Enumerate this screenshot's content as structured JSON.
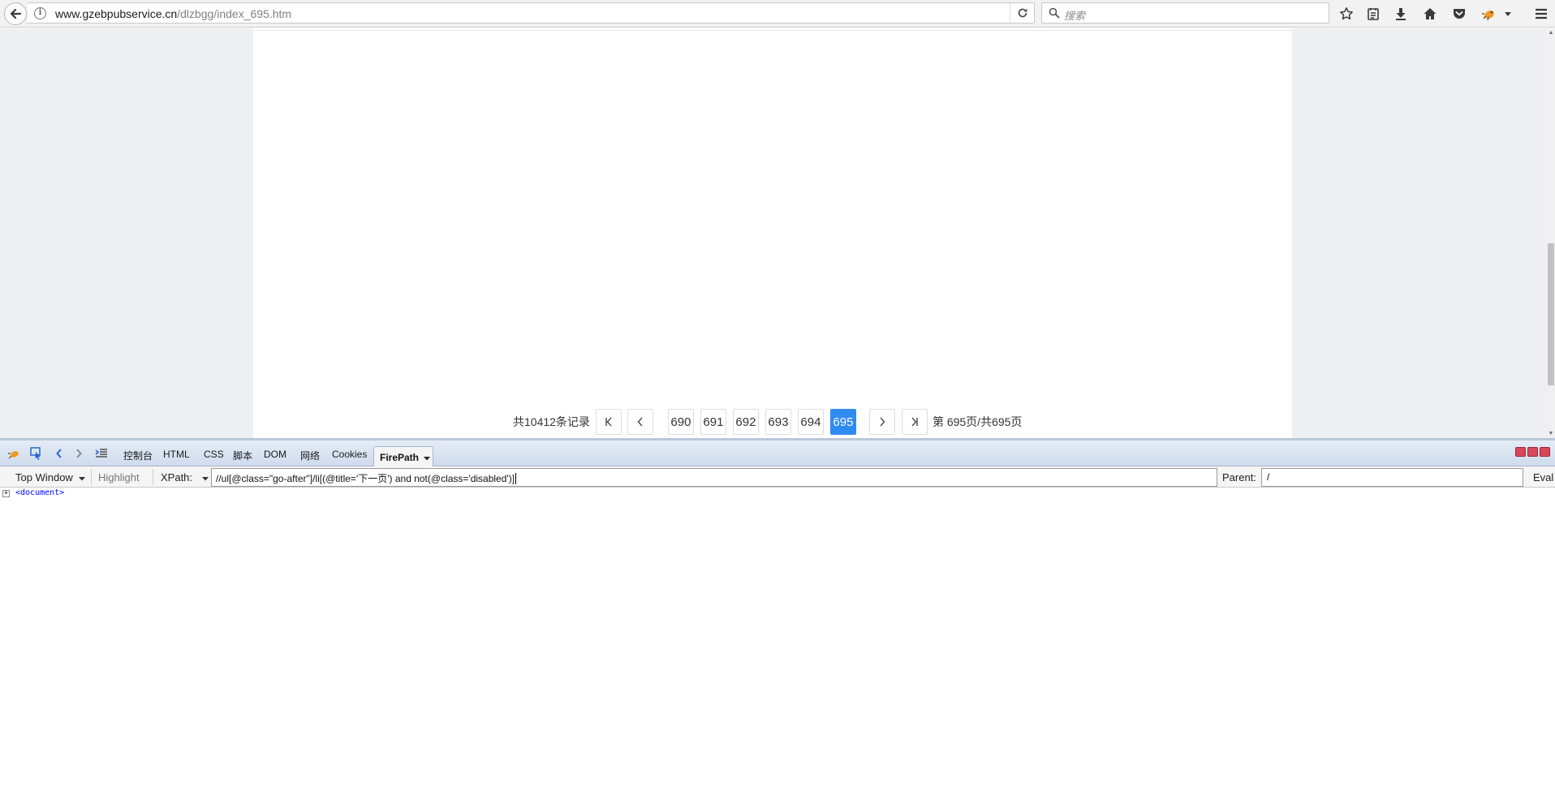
{
  "browser": {
    "url_host": "www.gzebpubservice.cn",
    "url_path": "/dlzbgg/index_695.htm",
    "search_placeholder": "搜索",
    "icons": [
      "back-icon",
      "info-icon",
      "reload-icon",
      "search-icon",
      "bookmark-star-icon",
      "reading-list-icon",
      "download-icon",
      "home-icon",
      "pocket-icon",
      "firebug-icon",
      "menu-dropdown-icon",
      "hamburger-menu-icon"
    ]
  },
  "pager": {
    "total": "共10412条记录",
    "first_label": "K",
    "prev_label": "<",
    "pages": [
      "690",
      "691",
      "692",
      "693",
      "694",
      "695"
    ],
    "current_page": "695",
    "next_label": ">",
    "last_label": ">|",
    "page_info": "第 695页/共695页",
    "active_color": "#2f8bf0"
  },
  "devtools": {
    "tabs": [
      "控制台",
      "HTML",
      "CSS",
      "脚本",
      "DOM",
      "网络",
      "Cookies"
    ],
    "active_tab": "FirePath",
    "window_label": "Top Window",
    "highlight_label": "Highlight",
    "xpath_label": "XPath:",
    "xpath_value": "//ul[@class=\"go-after\"]/li[(@title='下一页') and not(@class='disabled')]",
    "parent_label": "Parent:",
    "parent_value": "/",
    "eval_label": "Eval",
    "tree_root": "<document>"
  }
}
